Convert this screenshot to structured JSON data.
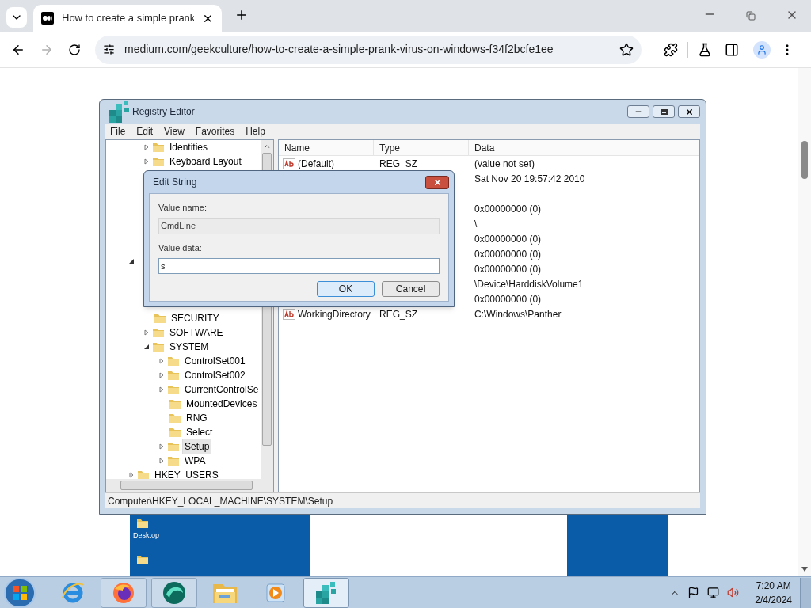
{
  "browser": {
    "tabs": [
      {
        "title": "How to create a simple prank",
        "selected": true
      }
    ],
    "address": "medium.com/geekculture/how-to-create-a-simple-prank-virus-on-windows-f34f2bcfe1ee",
    "forward_enabled": false
  },
  "regedit": {
    "title": "Registry Editor",
    "menu": [
      "File",
      "Edit",
      "View",
      "Favorites",
      "Help"
    ],
    "tree": [
      {
        "children": [
          {
            "label": "Identities",
            "expanded": false,
            "selected": false
          },
          {
            "label": "Keyboard Layout",
            "expanded": false,
            "selected": false
          }
        ]
      },
      {
        "expanded": true,
        "children": [
          {
            "label": "SECURITY",
            "selected": false
          },
          {
            "label": "SOFTWARE",
            "expanded": false,
            "selected": false
          },
          {
            "label": "SYSTEM",
            "expanded": true,
            "selected": false,
            "children": [
              {
                "label": "ControlSet001",
                "expanded": false,
                "selected": false
              },
              {
                "label": "ControlSet002",
                "expanded": false,
                "selected": false
              },
              {
                "label": "CurrentControlSe",
                "expanded": false,
                "selected": false
              },
              {
                "label": "MountedDevices",
                "selected": false
              },
              {
                "label": "RNG",
                "selected": false
              },
              {
                "label": "Select",
                "selected": false
              },
              {
                "label": "Setup",
                "expanded": false,
                "selected": true
              },
              {
                "label": "WPA",
                "expanded": false,
                "selected": false
              }
            ]
          }
        ]
      },
      {
        "label": "HKEY_USERS",
        "expanded": false,
        "selected": false
      }
    ],
    "columns": [
      "Name",
      "Type",
      "Data"
    ],
    "rows": [
      {
        "kind": "string",
        "name": "(Default)",
        "type": "REG_SZ",
        "data": "(value not set)"
      },
      {
        "data": "Sat Nov 20 19:57:42 2010"
      },
      {},
      {
        "data": "0x00000000 (0)"
      },
      {
        "data": "\\"
      },
      {
        "data": "0x00000000 (0)"
      },
      {
        "data": "0x00000000 (0)"
      },
      {
        "data": "0x00000000 (0)"
      },
      {
        "data": "\\Device\\HarddiskVolume1"
      },
      {
        "data": "0x00000000 (0)"
      },
      {
        "kind": "string",
        "name": "WorkingDirectory",
        "type": "REG_SZ",
        "data": "C:\\Windows\\Panther"
      }
    ],
    "status": "Computer\\HKEY_LOCAL_MACHINE\\SYSTEM\\Setup"
  },
  "dialog": {
    "title": "Edit String",
    "name_label": "Value name:",
    "name_value": "CmdLine",
    "data_label": "Value data:",
    "data_value": "s",
    "buttons": [
      {
        "label": "OK",
        "default": true
      },
      {
        "label": "Cancel",
        "default": false
      }
    ]
  },
  "desktop": {
    "icon_label": "Desktop"
  },
  "taskbar": {
    "apps": [
      {
        "kind": "ie",
        "running": false,
        "selected": false
      },
      {
        "kind": "firefox",
        "running": true,
        "selected": false
      },
      {
        "kind": "orb",
        "running": true,
        "selected": false
      },
      {
        "kind": "explorer",
        "running": false,
        "selected": false
      },
      {
        "kind": "media",
        "running": false,
        "selected": false
      },
      {
        "kind": "regedit",
        "running": true,
        "selected": true
      }
    ],
    "time": "7:20 AM",
    "date": "2/4/2024"
  }
}
